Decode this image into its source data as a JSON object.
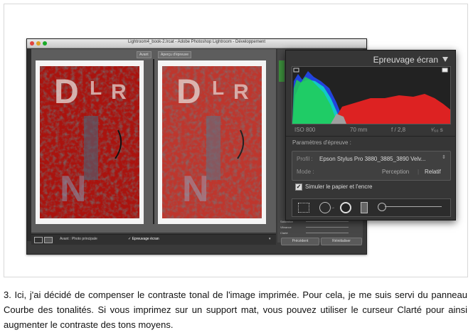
{
  "window": {
    "title": "Lightroom4_book-2.lrcat - Adobe Photoshop Lightroom - Développement",
    "view_tabs": [
      "Avant",
      "Aperçu d'épreuve"
    ]
  },
  "bottom_toolbar": {
    "before_label": "Avant : Photo principale",
    "softproof_label": "Epreuvage écran"
  },
  "right_panel": {
    "sliders": [
      "Saturation",
      "Vibrance",
      "Clarté"
    ],
    "buttons": [
      "Précédent",
      "Réinitialiser"
    ]
  },
  "softproof_panel": {
    "title": "Epreuvage écran",
    "histogram_info": {
      "iso": "ISO 800",
      "focal": "70 mm",
      "aperture": "f / 2,8",
      "shutter": "¹⁄₆₀ s"
    },
    "section_label": "Paramètres d'épreuve :",
    "profile_label": "Profil :",
    "profile_value": "Epson Stylus Pro 3880_3885_3890 Velv...",
    "mode_label": "Mode :",
    "mode_options": [
      "Perception",
      "Relatif"
    ],
    "simulate_label": "Simuler le papier et l'encre",
    "simulate_checked": true
  },
  "caption": "3. Ici, j'ai décidé de compenser le contraste tonal de l'image imprimée. Pour cela, je me suis servi du panneau Courbe des tonalités. Si vous imprimez sur un support mat, vous pouvez utiliser le curseur Clarté pour ainsi augmenter le contraste des tons moyens."
}
